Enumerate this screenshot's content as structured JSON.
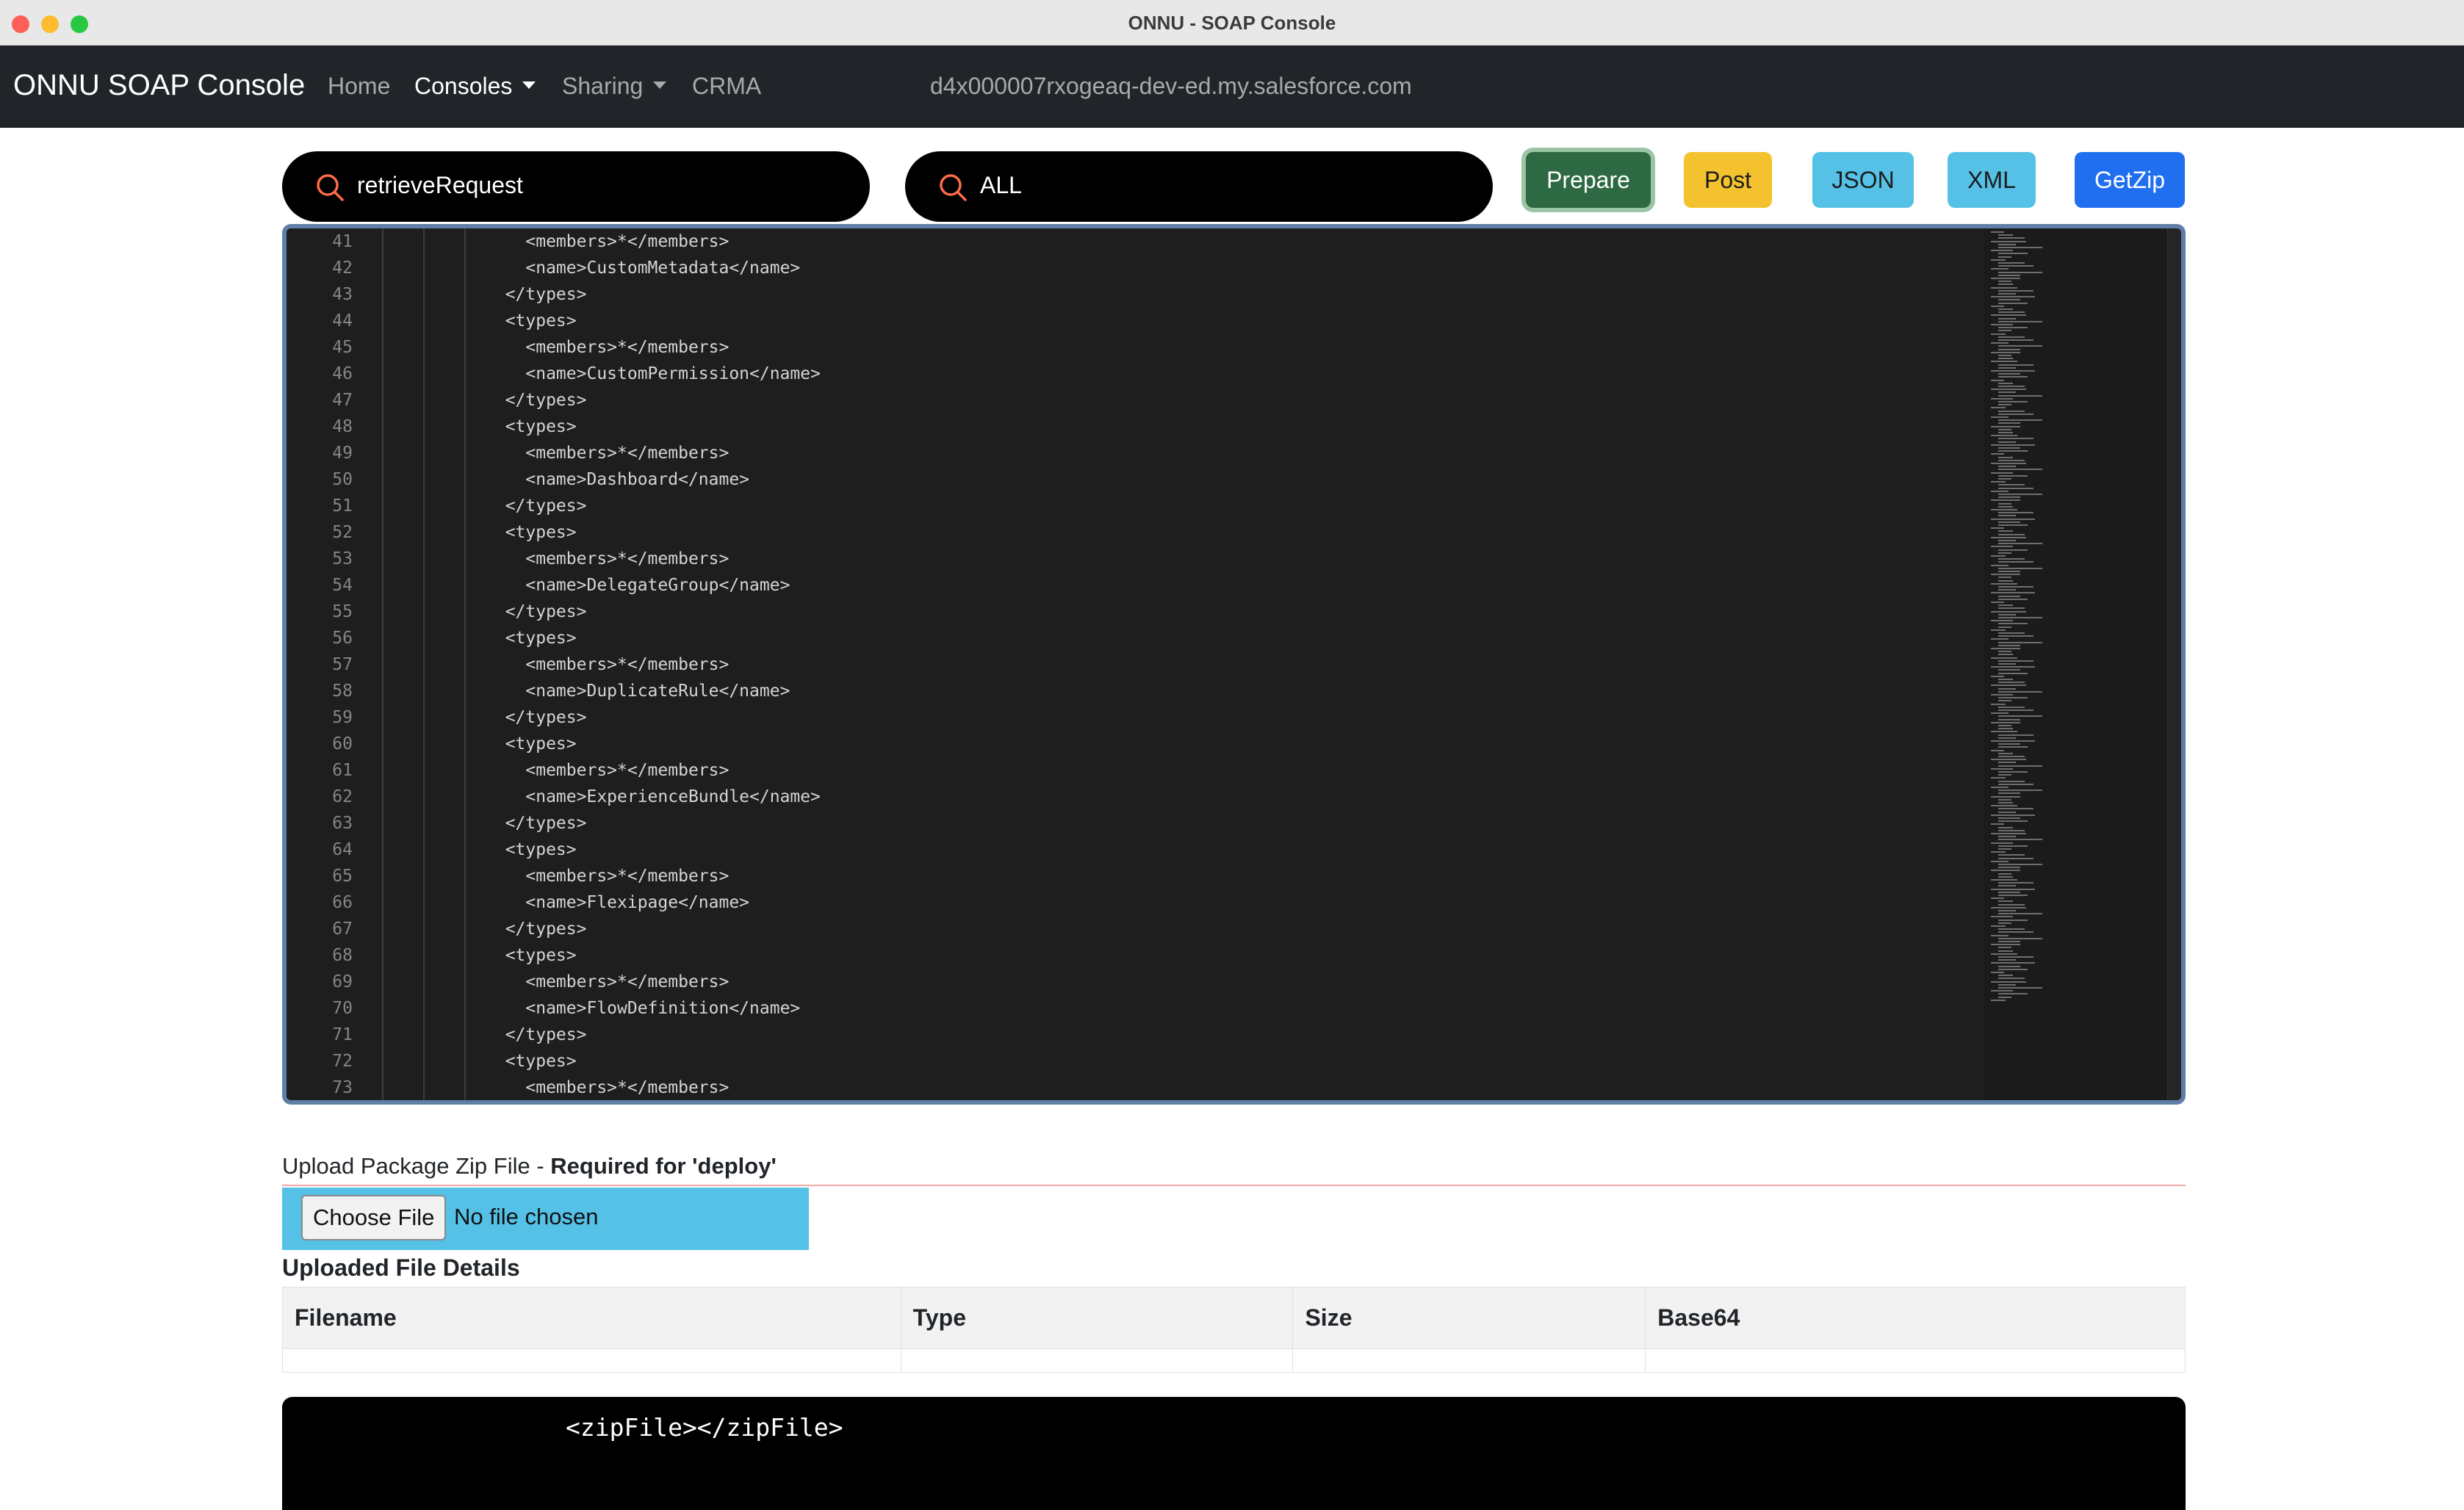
{
  "window": {
    "title": "ONNU - SOAP Console"
  },
  "navbar": {
    "brand": "ONNU SOAP Console",
    "links": [
      {
        "label": "Home",
        "active": false,
        "dropdown": false
      },
      {
        "label": "Consoles",
        "active": true,
        "dropdown": true
      },
      {
        "label": "Sharing",
        "active": false,
        "dropdown": true
      },
      {
        "label": "CRMA",
        "active": false,
        "dropdown": false
      }
    ],
    "host": "d4x000007rxogeaq-dev-ed.my.salesforce.com"
  },
  "toolbar": {
    "method_search": "retrieveRequest",
    "filter_search": "ALL",
    "buttons": {
      "prepare": "Prepare",
      "post": "Post",
      "json": "JSON",
      "xml": "XML",
      "getzip": "GetZip"
    }
  },
  "editor": {
    "lines": [
      {
        "n": "41",
        "text": "    <members>*</members>"
      },
      {
        "n": "42",
        "text": "    <name>CustomMetadata</name>"
      },
      {
        "n": "43",
        "text": "  </types>"
      },
      {
        "n": "44",
        "text": "  <types>"
      },
      {
        "n": "45",
        "text": "    <members>*</members>"
      },
      {
        "n": "46",
        "text": "    <name>CustomPermission</name>"
      },
      {
        "n": "47",
        "text": "  </types>"
      },
      {
        "n": "48",
        "text": "  <types>"
      },
      {
        "n": "49",
        "text": "    <members>*</members>"
      },
      {
        "n": "50",
        "text": "    <name>Dashboard</name>"
      },
      {
        "n": "51",
        "text": "  </types>"
      },
      {
        "n": "52",
        "text": "  <types>"
      },
      {
        "n": "53",
        "text": "    <members>*</members>"
      },
      {
        "n": "54",
        "text": "    <name>DelegateGroup</name>"
      },
      {
        "n": "55",
        "text": "  </types>"
      },
      {
        "n": "56",
        "text": "  <types>"
      },
      {
        "n": "57",
        "text": "    <members>*</members>"
      },
      {
        "n": "58",
        "text": "    <name>DuplicateRule</name>"
      },
      {
        "n": "59",
        "text": "  </types>"
      },
      {
        "n": "60",
        "text": "  <types>"
      },
      {
        "n": "61",
        "text": "    <members>*</members>"
      },
      {
        "n": "62",
        "text": "    <name>ExperienceBundle</name>"
      },
      {
        "n": "63",
        "text": "  </types>"
      },
      {
        "n": "64",
        "text": "  <types>"
      },
      {
        "n": "65",
        "text": "    <members>*</members>"
      },
      {
        "n": "66",
        "text": "    <name>Flexipage</name>"
      },
      {
        "n": "67",
        "text": "  </types>"
      },
      {
        "n": "68",
        "text": "  <types>"
      },
      {
        "n": "69",
        "text": "    <members>*</members>"
      },
      {
        "n": "70",
        "text": "    <name>FlowDefinition</name>"
      },
      {
        "n": "71",
        "text": "  </types>"
      },
      {
        "n": "72",
        "text": "  <types>"
      },
      {
        "n": "73",
        "text": "    <members>*</members>"
      }
    ]
  },
  "upload": {
    "label": "Upload Package Zip File - ",
    "label_bold": "Required for 'deploy'",
    "choose_button": "Choose File",
    "file_status": "No file chosen"
  },
  "uploaded": {
    "title": "Uploaded File Details",
    "columns": [
      "Filename",
      "Type",
      "Size",
      "Base64"
    ]
  },
  "zip_output": {
    "text": "<zipFile></zipFile>"
  },
  "colors": {
    "navbar": "#212529",
    "prepare": "#2d6a44",
    "post": "#f4c12f",
    "info": "#55c1e6",
    "getzip": "#1f6ff0",
    "search_icon": "#ff6b4a"
  }
}
